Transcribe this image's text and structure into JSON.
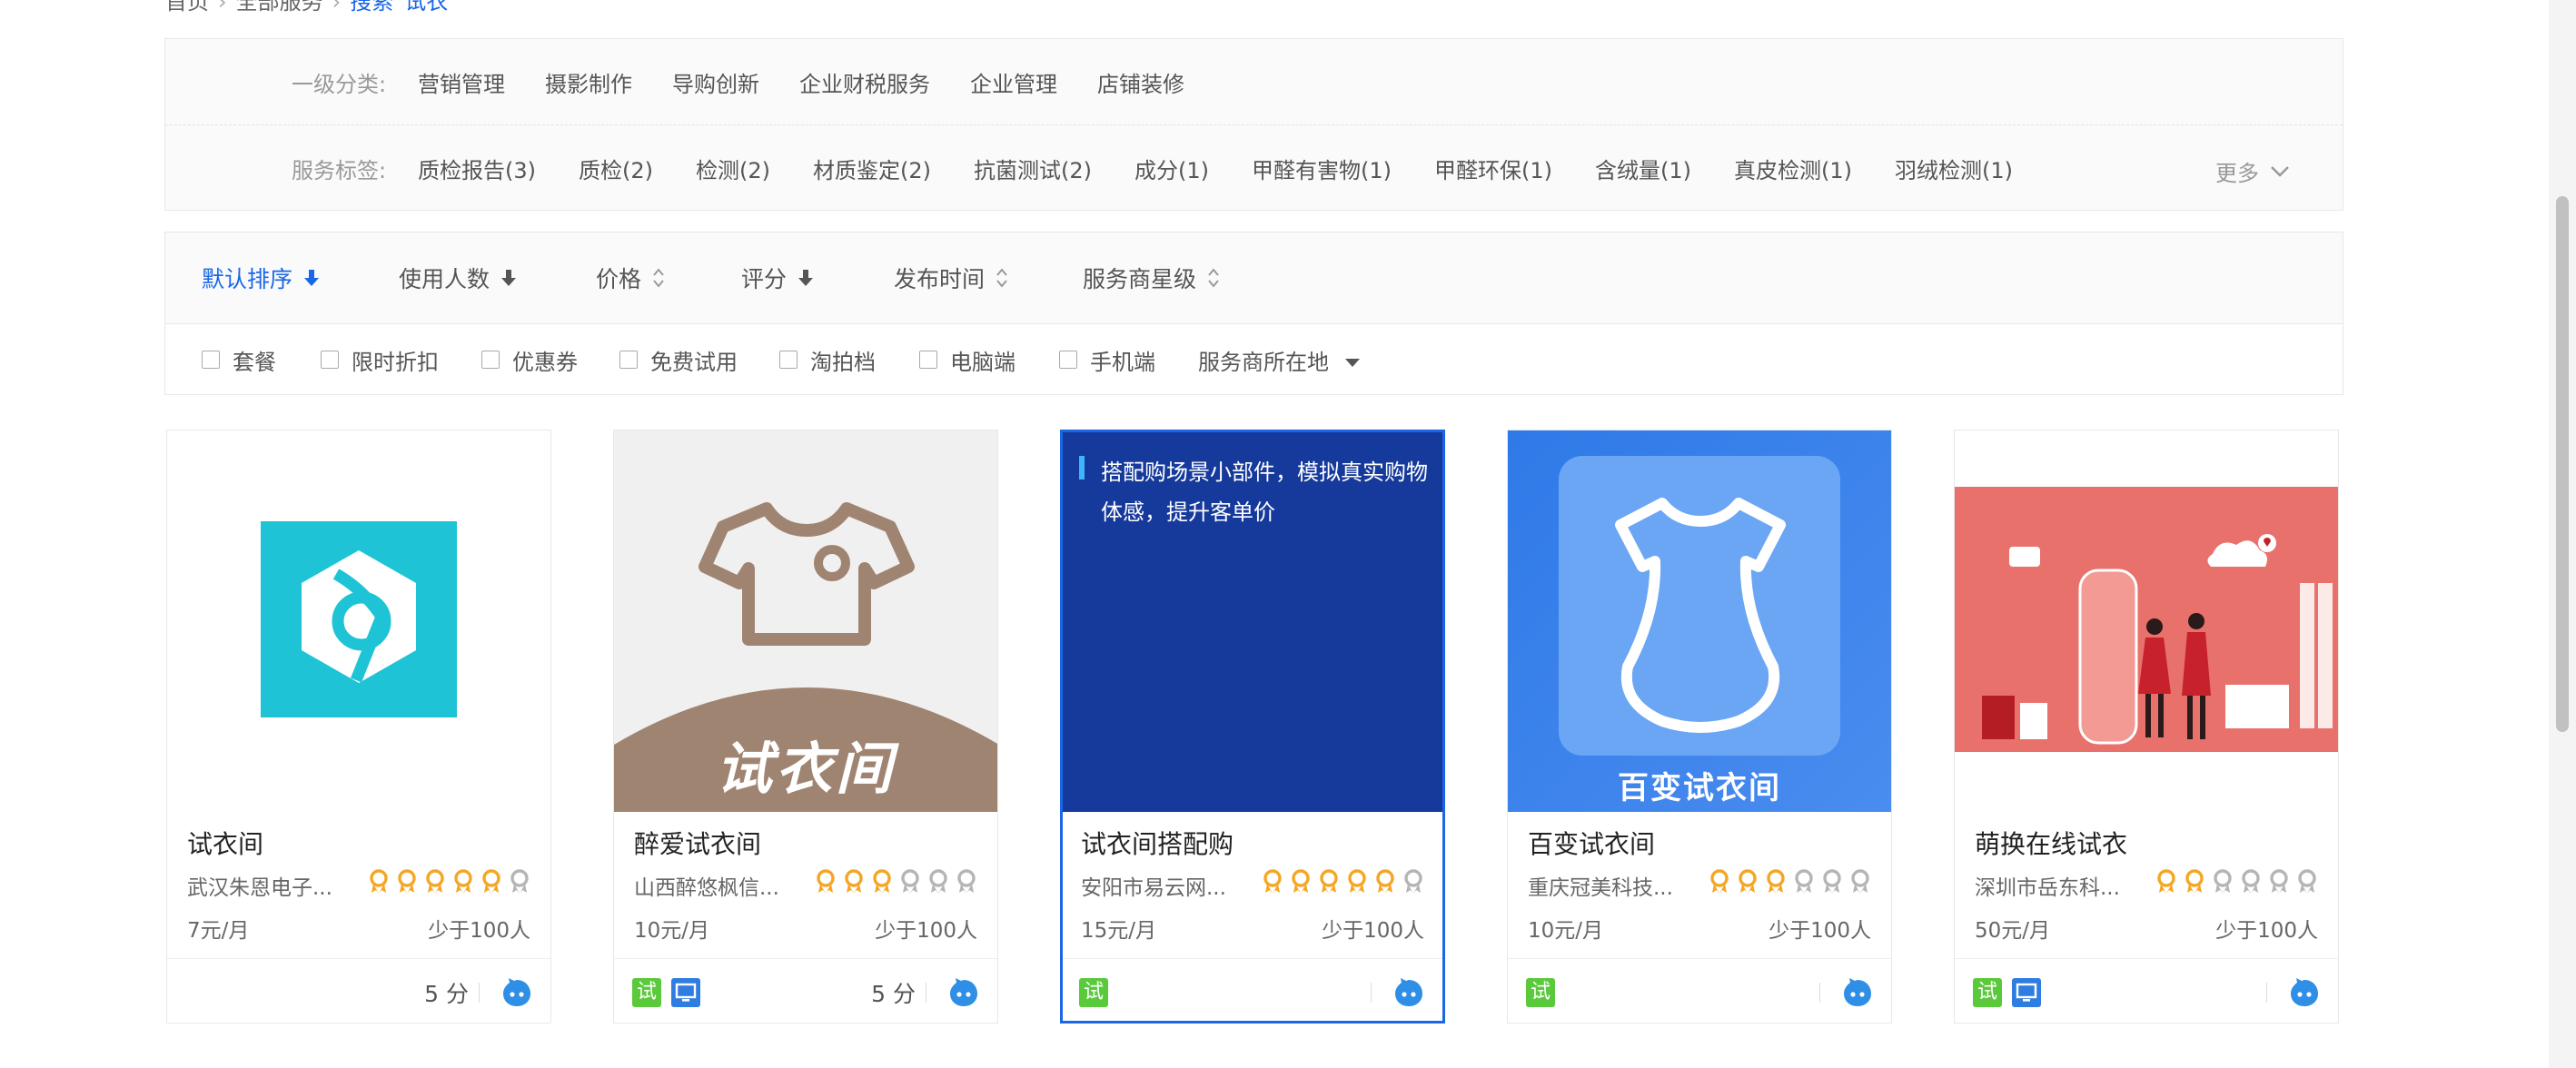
{
  "breadcrumb": {
    "home": "首页",
    "all": "全部服务",
    "search": "搜索",
    "keyword": "试衣"
  },
  "categories": {
    "label": "一级分类:",
    "items": [
      "营销管理",
      "摄影制作",
      "导购创新",
      "企业财税服务",
      "企业管理",
      "店铺装修"
    ]
  },
  "tags": {
    "label": "服务标签:",
    "items": [
      "质检报告(3)",
      "质检(2)",
      "检测(2)",
      "材质鉴定(2)",
      "抗菌测试(2)",
      "成分(1)",
      "甲醛有害物(1)",
      "甲醛环保(1)",
      "含绒量(1)",
      "真皮检测(1)",
      "羽绒检测(1)"
    ],
    "more": "更多"
  },
  "sort": {
    "default": "默认排序",
    "users": "使用人数",
    "price": "价格",
    "rating": "评分",
    "publish": "发布时间",
    "provider_stars": "服务商星级"
  },
  "filters": {
    "package": "套餐",
    "discount": "限时折扣",
    "coupon": "优惠券",
    "free_trial": "免费试用",
    "taopai": "淘拍档",
    "pc": "电脑端",
    "mobile": "手机端",
    "location": "服务商所在地"
  },
  "colors": {
    "accent": "#1a66e6",
    "star_gold": "#f5a623",
    "star_gray": "#b5b5b5",
    "trial_badge": "#5ac93b",
    "pc_badge": "#2f7de1"
  },
  "badges": {
    "trial": "试"
  },
  "cards": [
    {
      "title": "试衣间",
      "shop": "武汉朱恩电子...",
      "rating": 5,
      "price": "7元/月",
      "users": "少于100人",
      "score": "5 分",
      "thumb_text": ""
    },
    {
      "title": "醉爱试衣间",
      "shop": "山西醉悠枫信...",
      "rating": 3,
      "price": "10元/月",
      "users": "少于100人",
      "score": "5 分",
      "thumb_text": "试衣间"
    },
    {
      "title": "试衣间搭配购",
      "shop": "安阳市易云网...",
      "rating": 5,
      "price": "15元/月",
      "users": "少于100人",
      "score": "",
      "thumb_text": "搭配购场景小部件，模拟真实购物体感，提升客单价"
    },
    {
      "title": "百变试衣间",
      "shop": "重庆冠美科技...",
      "rating": 3,
      "price": "10元/月",
      "users": "少于100人",
      "score": "",
      "thumb_text": "百变试衣间"
    },
    {
      "title": "萌换在线试衣",
      "shop": "深圳市岳东科...",
      "rating": 2,
      "price": "50元/月",
      "users": "少于100人",
      "score": "",
      "thumb_text": ""
    }
  ]
}
